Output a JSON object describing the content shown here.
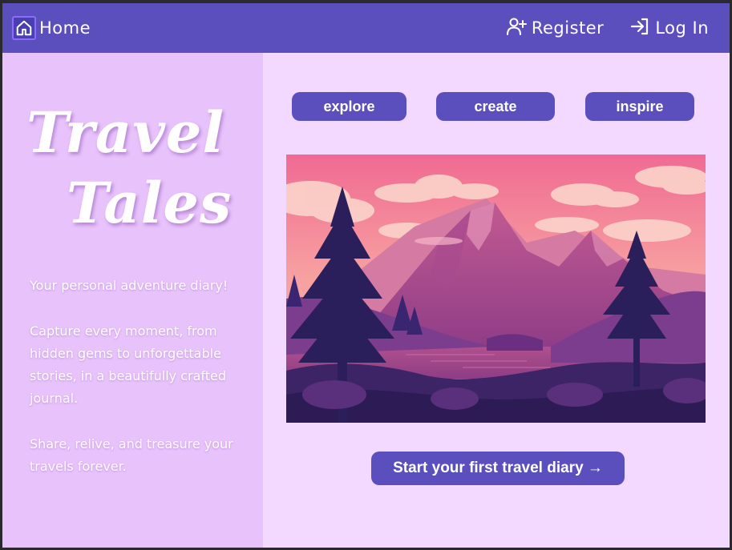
{
  "nav": {
    "home_label": "Home",
    "register_label": "Register",
    "login_label": "Log In",
    "icons": {
      "home": "home-icon",
      "register": "user-plus-icon",
      "login": "log-in-icon"
    }
  },
  "hero": {
    "title_line1": "Travel",
    "title_line2": "Tales",
    "paragraph1": "Your personal adventure diary!",
    "paragraph2": "Capture every moment, from hidden gems to unforgettable stories, in a beautifully crafted journal.",
    "paragraph3": "Share, relive, and treasure your travels forever."
  },
  "pills": {
    "explore": "explore",
    "create": "create",
    "inspire": "inspire"
  },
  "cta": {
    "label": "Start your first travel diary →"
  },
  "colors": {
    "nav_bg": "#5b4fbd",
    "page_bg": "#f3d9ff",
    "left_panel_bg": "#e8c2fb",
    "button_bg": "#5b4fbd",
    "text_light": "#ffffff"
  }
}
